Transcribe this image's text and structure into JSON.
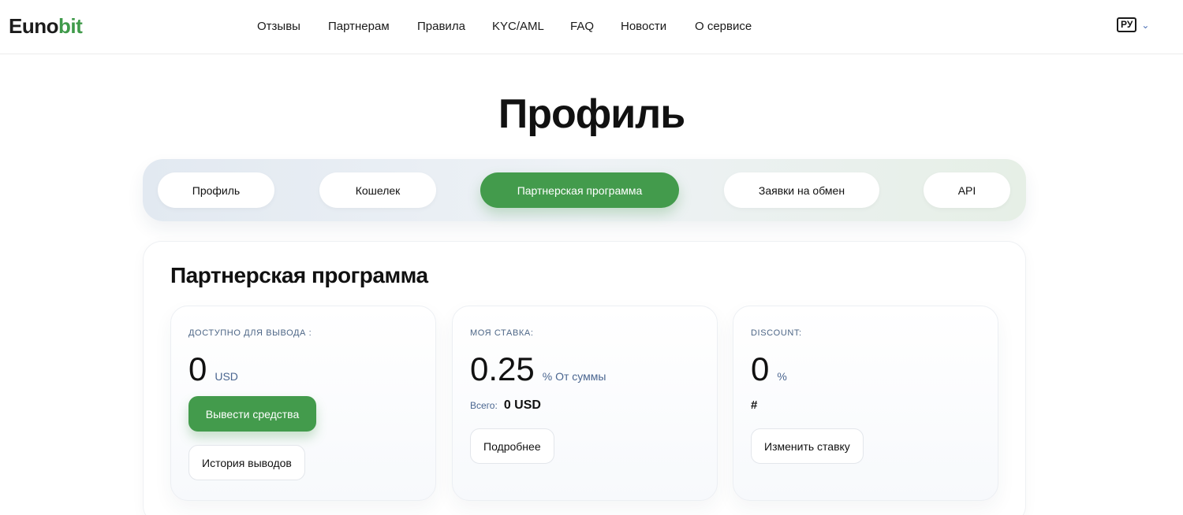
{
  "header": {
    "logo_part1": "Euno",
    "logo_part2": "bit",
    "nav": [
      "Отзывы",
      "Партнерам",
      "Правила",
      "KYC/AML",
      "FAQ",
      "Новости",
      "О сервисе"
    ],
    "lang": "РУ",
    "lang_chevron": "⌄"
  },
  "page_title": "Профиль",
  "tabs": [
    {
      "label": "Профиль",
      "active": false
    },
    {
      "label": "Кошелек",
      "active": false
    },
    {
      "label": "Партнерская программа",
      "active": true
    },
    {
      "label": "Заявки на обмен",
      "active": false
    },
    {
      "label": "API",
      "active": false
    }
  ],
  "section_title": "Партнерская программа",
  "cards": {
    "available": {
      "label": "доступно для вывода :",
      "value": "0",
      "unit": "USD",
      "withdraw_button": "Вывести средства",
      "history_button": "История выводов"
    },
    "rate": {
      "label": "Моя ставка:",
      "value": "0.25",
      "unit": "% От суммы",
      "total_label": "Всего:",
      "total_value": "0 USD",
      "details_button": "Подробнее"
    },
    "discount": {
      "label": "Discount:",
      "value": "0",
      "unit": "%",
      "hash": "#",
      "change_button": "Изменить ставку"
    }
  },
  "colors": {
    "accent_green": "#439b4c",
    "label_blue": "#4d6686"
  }
}
